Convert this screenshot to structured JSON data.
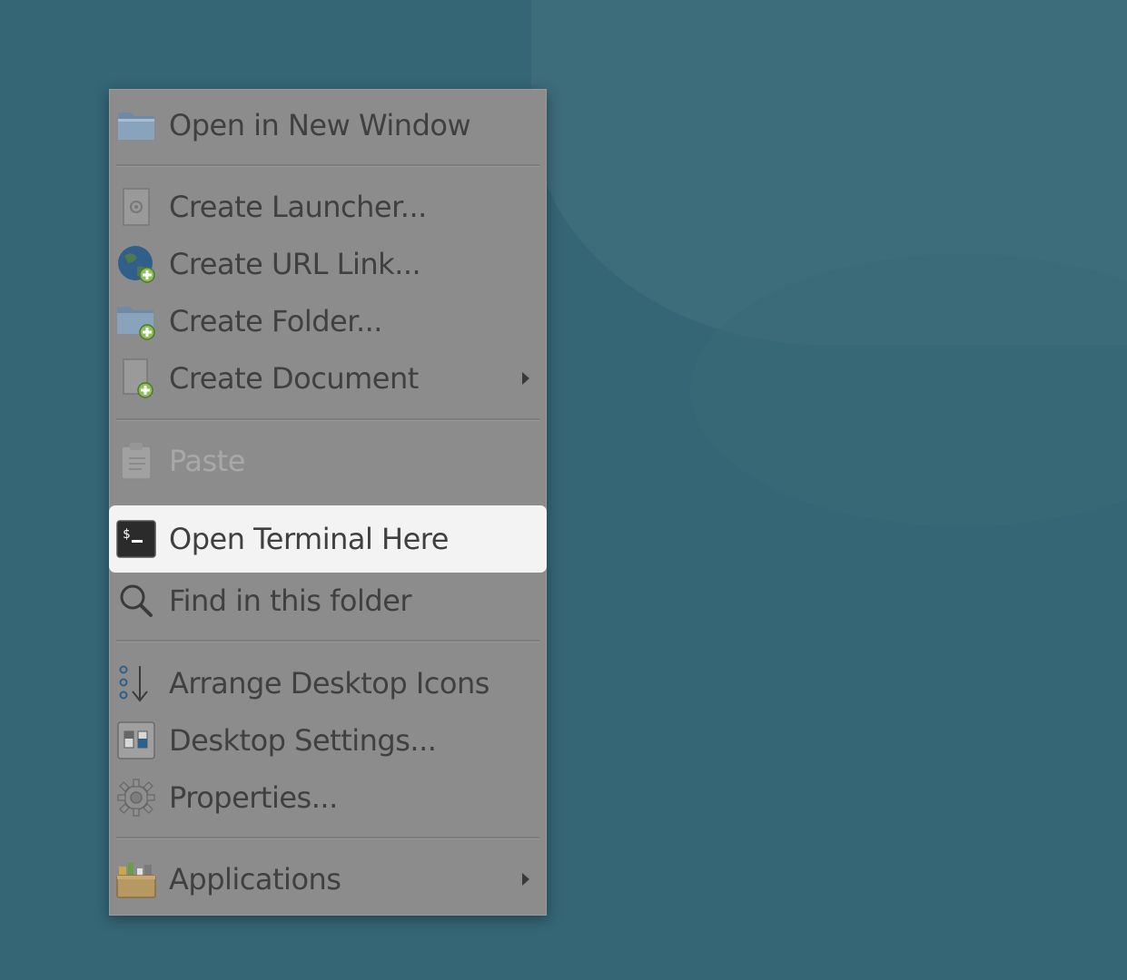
{
  "menu": {
    "items": [
      {
        "label": "Open in New Window",
        "icon": "folder-icon"
      },
      {
        "label": "Create Launcher...",
        "icon": "launcher-icon"
      },
      {
        "label": "Create URL Link...",
        "icon": "globe-add-icon"
      },
      {
        "label": "Create Folder...",
        "icon": "folder-add-icon"
      },
      {
        "label": "Create Document",
        "icon": "document-add-icon",
        "submenu": true
      },
      {
        "label": "Paste",
        "icon": "clipboard-icon",
        "disabled": true
      },
      {
        "label": "Open Terminal Here",
        "icon": "terminal-icon",
        "highlighted": true
      },
      {
        "label": "Find in this folder",
        "icon": "search-icon"
      },
      {
        "label": "Arrange Desktop Icons",
        "icon": "arrange-icon"
      },
      {
        "label": "Desktop Settings...",
        "icon": "desktop-settings-icon"
      },
      {
        "label": "Properties...",
        "icon": "gear-icon"
      },
      {
        "label": "Applications",
        "icon": "applications-icon",
        "submenu": true
      }
    ]
  },
  "colors": {
    "desktop": "#346675",
    "menu_bg": "#8c8c8c",
    "highlight": "#f3f3f3"
  }
}
